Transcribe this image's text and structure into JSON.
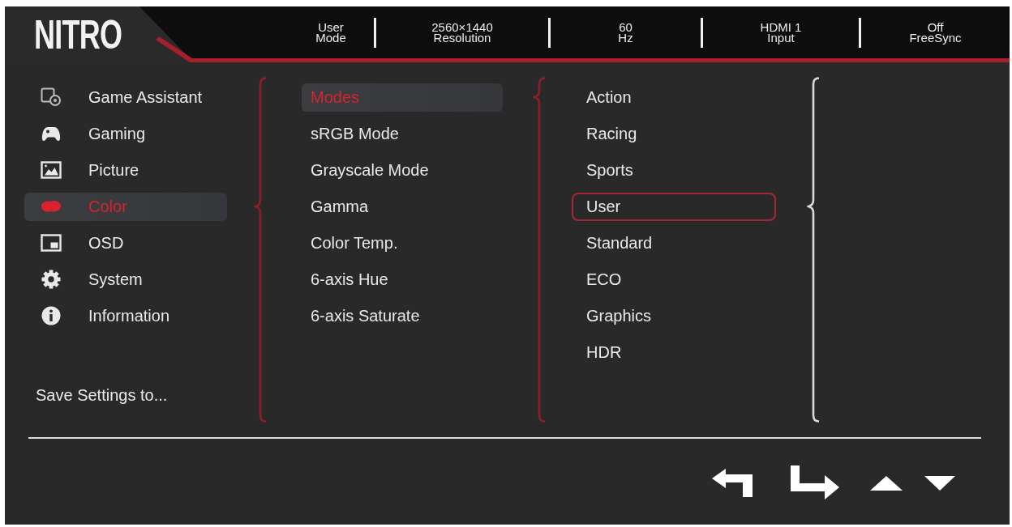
{
  "header": {
    "logo": "NITRO",
    "status": [
      {
        "value": "User",
        "label": "Mode"
      },
      {
        "value": "2560×1440",
        "label": "Resolution"
      },
      {
        "value": "60",
        "label": "Hz"
      },
      {
        "value": "HDMI 1",
        "label": "Input"
      },
      {
        "value": "Off",
        "label": "FreeSync"
      }
    ]
  },
  "main_menu": {
    "items": [
      {
        "label": "Game Assistant",
        "selected": false
      },
      {
        "label": "Gaming",
        "selected": false
      },
      {
        "label": "Picture",
        "selected": false
      },
      {
        "label": "Color",
        "selected": true
      },
      {
        "label": "OSD",
        "selected": false
      },
      {
        "label": "System",
        "selected": false
      },
      {
        "label": "Information",
        "selected": false
      }
    ],
    "save_settings": "Save Settings to..."
  },
  "color_menu": {
    "items": [
      {
        "label": "Modes",
        "selected": true
      },
      {
        "label": "sRGB Mode",
        "selected": false
      },
      {
        "label": "Grayscale Mode",
        "selected": false
      },
      {
        "label": "Gamma",
        "selected": false
      },
      {
        "label": "Color Temp.",
        "selected": false
      },
      {
        "label": "6-axis Hue",
        "selected": false
      },
      {
        "label": "6-axis Saturate",
        "selected": false
      }
    ]
  },
  "mode_options": {
    "items": [
      {
        "label": "Action",
        "selected": false
      },
      {
        "label": "Racing",
        "selected": false
      },
      {
        "label": "Sports",
        "selected": false
      },
      {
        "label": "User",
        "selected": true
      },
      {
        "label": "Standard",
        "selected": false
      },
      {
        "label": "ECO",
        "selected": false
      },
      {
        "label": "Graphics",
        "selected": false
      },
      {
        "label": "HDR",
        "selected": false
      }
    ]
  }
}
